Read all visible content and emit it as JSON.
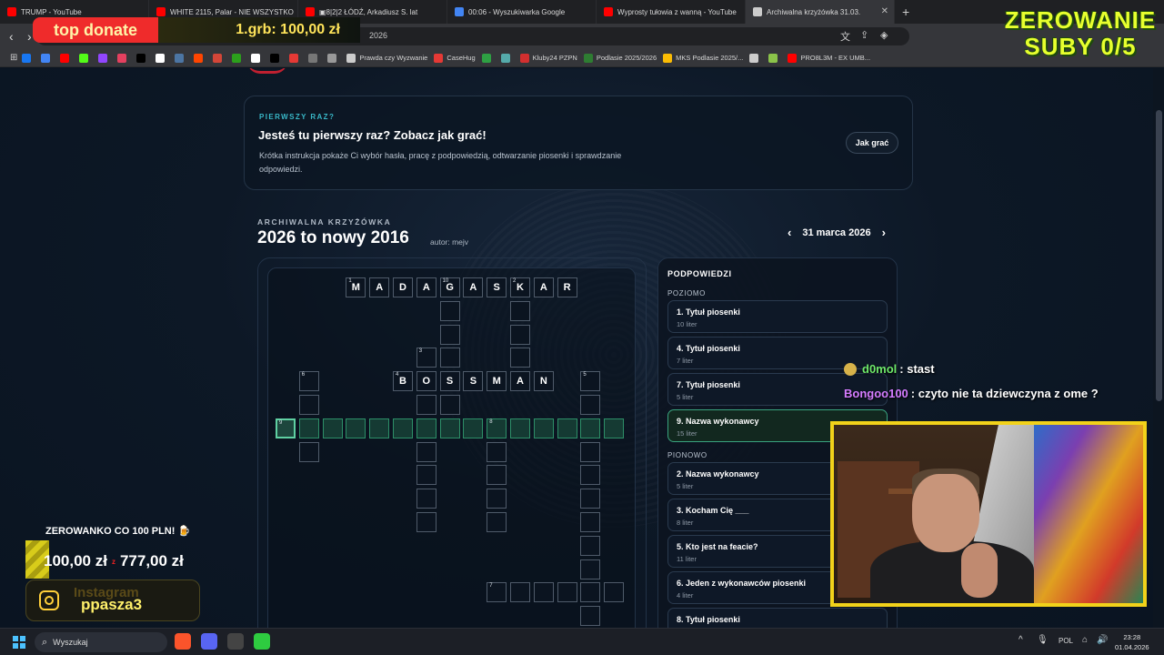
{
  "browser": {
    "tabs": [
      {
        "title": "TRUMP - YouTube",
        "color": "#ff0000"
      },
      {
        "title": "WHITE 2115, Palar - NIE WSZYSTKO",
        "color": "#ff0000"
      },
      {
        "title": "▣8|2|2 ŁÓDŹ, Arkadiusz S. lat",
        "color": "#ff0000"
      },
      {
        "title": "00:06 - Wyszukiwarka Google",
        "color": "#4285f4"
      },
      {
        "title": "Wyprosty tułowia z wanną - YouTube",
        "color": "#ff0000"
      },
      {
        "title": "Archiwalna krzyżówka 31.03.",
        "color": "#cccccc",
        "active": true
      }
    ],
    "url_fragment": "2026",
    "bookmarks": [
      {
        "label": "",
        "color": "#1877f2"
      },
      {
        "label": "",
        "color": "#4285f4"
      },
      {
        "label": "",
        "color": "#ff0000"
      },
      {
        "label": "",
        "color": "#53fc18"
      },
      {
        "label": "",
        "color": "#9146ff"
      },
      {
        "label": "",
        "color": "#e4405f"
      },
      {
        "label": "",
        "color": "#000000"
      },
      {
        "label": "",
        "color": "#ffffff"
      },
      {
        "label": "",
        "color": "#4c75a3"
      },
      {
        "label": "",
        "color": "#ff4500"
      },
      {
        "label": "",
        "color": "#d44638"
      },
      {
        "label": "",
        "color": "#2ca01c"
      },
      {
        "label": "",
        "color": "#ffffff"
      },
      {
        "label": "",
        "color": "#000000"
      },
      {
        "label": "",
        "color": "#e53935"
      },
      {
        "label": "",
        "color": "#777777"
      },
      {
        "label": "",
        "color": "#999999"
      },
      {
        "label": "Prawda czy Wyzwanie",
        "color": "#cccccc"
      },
      {
        "label": "CaseHug",
        "color": "#e53935"
      },
      {
        "label": "",
        "color": "#2ea043"
      },
      {
        "label": "",
        "color": "#5aa"
      },
      {
        "label": "Kluby24 PZPN",
        "color": "#d32f2f"
      },
      {
        "label": "Podlasie 2025/2026",
        "color": "#2e7d32"
      },
      {
        "label": "MKS Podlasie 2025/...",
        "color": "#fbbc04"
      },
      {
        "label": "",
        "color": "#cccccc"
      },
      {
        "label": "",
        "color": "#8bc34a"
      },
      {
        "label": "PRO8L3M - EX UMB...",
        "color": "#ff0000"
      }
    ]
  },
  "intro": {
    "eyebrow": "PIERWSZY RAZ?",
    "title": "Jesteś tu pierwszy raz? Zobacz jak grać!",
    "description": "Krótka instrukcja pokaże Ci wybór hasła, pracę z podpowiedzią, odtwarzanie piosenki i sprawdzanie odpowiedzi.",
    "button": "Jak grać"
  },
  "archive": {
    "label": "ARCHIWALNA KRZYŻÓWKA",
    "title": "2026 to nowy 2016",
    "author": "autor: mejv",
    "date": "31 marca 2026",
    "prev": "‹",
    "next": "›"
  },
  "crossword": {
    "cells": [
      {
        "c": 3,
        "r": 0,
        "ch": "M",
        "n": "1"
      },
      {
        "c": 4,
        "r": 0,
        "ch": "A"
      },
      {
        "c": 5,
        "r": 0,
        "ch": "D"
      },
      {
        "c": 6,
        "r": 0,
        "ch": "A"
      },
      {
        "c": 7,
        "r": 0,
        "ch": "G",
        "n": "10"
      },
      {
        "c": 8,
        "r": 0,
        "ch": "A"
      },
      {
        "c": 9,
        "r": 0,
        "ch": "S"
      },
      {
        "c": 10,
        "r": 0,
        "ch": "K",
        "n": "2"
      },
      {
        "c": 11,
        "r": 0,
        "ch": "A"
      },
      {
        "c": 12,
        "r": 0,
        "ch": "R"
      },
      {
        "c": 7,
        "r": 1
      },
      {
        "c": 10,
        "r": 1
      },
      {
        "c": 7,
        "r": 2
      },
      {
        "c": 10,
        "r": 2
      },
      {
        "c": 6,
        "r": 3,
        "n": "3"
      },
      {
        "c": 7,
        "r": 3
      },
      {
        "c": 10,
        "r": 3
      },
      {
        "c": 1,
        "r": 4,
        "n": "6"
      },
      {
        "c": 5,
        "r": 4,
        "ch": "B",
        "n": "4"
      },
      {
        "c": 6,
        "r": 4,
        "ch": "O"
      },
      {
        "c": 7,
        "r": 4,
        "ch": "S"
      },
      {
        "c": 8,
        "r": 4,
        "ch": "S"
      },
      {
        "c": 9,
        "r": 4,
        "ch": "M"
      },
      {
        "c": 10,
        "r": 4,
        "ch": "A"
      },
      {
        "c": 11,
        "r": 4,
        "ch": "N"
      },
      {
        "c": 13,
        "r": 4,
        "n": "5"
      },
      {
        "c": 1,
        "r": 5
      },
      {
        "c": 6,
        "r": 5
      },
      {
        "c": 7,
        "r": 5
      },
      {
        "c": 13,
        "r": 5
      },
      {
        "c": 0,
        "r": 6,
        "n": "9",
        "sel": true
      },
      {
        "c": 1,
        "r": 6,
        "hl": true
      },
      {
        "c": 2,
        "r": 6,
        "hl": true
      },
      {
        "c": 3,
        "r": 6,
        "hl": true
      },
      {
        "c": 4,
        "r": 6,
        "hl": true
      },
      {
        "c": 5,
        "r": 6,
        "hl": true
      },
      {
        "c": 6,
        "r": 6,
        "hl": true
      },
      {
        "c": 7,
        "r": 6,
        "hl": true
      },
      {
        "c": 8,
        "r": 6,
        "hl": true
      },
      {
        "c": 9,
        "r": 6,
        "hl": true,
        "n": "8"
      },
      {
        "c": 10,
        "r": 6,
        "hl": true
      },
      {
        "c": 11,
        "r": 6,
        "hl": true
      },
      {
        "c": 12,
        "r": 6,
        "hl": true
      },
      {
        "c": 13,
        "r": 6,
        "hl": true
      },
      {
        "c": 14,
        "r": 6,
        "hl": true
      },
      {
        "c": 1,
        "r": 7
      },
      {
        "c": 6,
        "r": 7
      },
      {
        "c": 9,
        "r": 7
      },
      {
        "c": 13,
        "r": 7
      },
      {
        "c": 6,
        "r": 8
      },
      {
        "c": 9,
        "r": 8
      },
      {
        "c": 13,
        "r": 8
      },
      {
        "c": 6,
        "r": 9
      },
      {
        "c": 9,
        "r": 9
      },
      {
        "c": 13,
        "r": 9
      },
      {
        "c": 6,
        "r": 10
      },
      {
        "c": 9,
        "r": 10
      },
      {
        "c": 13,
        "r": 10
      },
      {
        "c": 13,
        "r": 11
      },
      {
        "c": 13,
        "r": 12
      },
      {
        "c": 9,
        "r": 13,
        "n": "7"
      },
      {
        "c": 10,
        "r": 13
      },
      {
        "c": 11,
        "r": 13
      },
      {
        "c": 12,
        "r": 13
      },
      {
        "c": 13,
        "r": 13
      },
      {
        "c": 14,
        "r": 13
      },
      {
        "c": 13,
        "r": 14
      }
    ]
  },
  "clues": {
    "heading": "PODPOWIEDZI",
    "across_label": "POZIOMO",
    "down_label": "PIONOWO",
    "across": [
      {
        "title": "1. Tytuł piosenki",
        "len": "10 liter"
      },
      {
        "title": "4. Tytuł piosenki",
        "len": "7 liter"
      },
      {
        "title": "7. Tytuł piosenki",
        "len": "5 liter"
      },
      {
        "title": "9. Nazwa wykonawcy",
        "len": "15 liter",
        "active": true
      }
    ],
    "down": [
      {
        "title": "2. Nazwa wykonawcy",
        "len": "5 liter"
      },
      {
        "title": "3. Kocham Cię ___",
        "len": "8 liter"
      },
      {
        "title": "5. Kto jest na feacie?",
        "len": "11 liter"
      },
      {
        "title": "6. Jeden z wykonawców piosenki",
        "len": "4 liter"
      },
      {
        "title": "8. Tytuł piosenki",
        "len": ""
      }
    ]
  },
  "taskbar": {
    "search_placeholder": "Wyszukaj",
    "lang": "POL",
    "time": "23:28",
    "date": "01.04.2026",
    "apps": [
      {
        "name": "brave-icon",
        "color": "#fb542b"
      },
      {
        "name": "discord-icon",
        "color": "#5865f2"
      },
      {
        "name": "obs-icon",
        "color": "#444444"
      },
      {
        "name": "app-icon",
        "color": "#2ecc40"
      }
    ]
  },
  "overlay": {
    "top_donate": "top donate",
    "top_donor": "1.grb: 100,00 zł",
    "zerowanie_line1": "ZEROWANIE",
    "zerowanie_line2": "SUBY 0/5",
    "goal_title": "ZEROWANKO CO 100 PLN! 🍺",
    "goal_current": "100,00 zł",
    "goal_total": "777,00 zł",
    "goal_progress": 0.13,
    "instagram_label": "Instagram",
    "instagram_handle": "ppasza3",
    "chat": [
      {
        "user": "d0mol",
        "msg": ": stast",
        "color": "#6ee86a",
        "emote": true
      },
      {
        "user": "Bongoo100",
        "msg": ": czyto nie ta dziewczyna z ome ?",
        "color": "#d57cff",
        "emote": false
      }
    ]
  }
}
